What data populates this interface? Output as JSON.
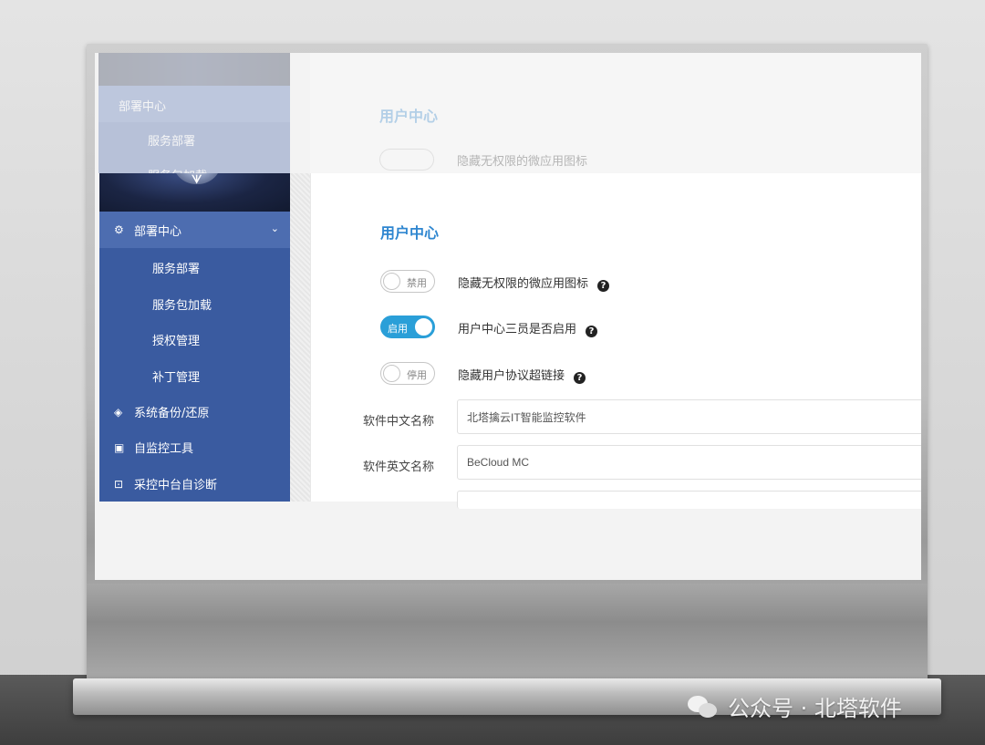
{
  "sidebar": {
    "section": {
      "label": "部署中心",
      "icon": "deploy-icon"
    },
    "sub_items": [
      "服务部署",
      "服务包加载",
      "授权管理",
      "补丁管理"
    ],
    "items": [
      {
        "label": "系统备份/还原",
        "icon": "layers-icon"
      },
      {
        "label": "自监控工具",
        "icon": "monitor-icon"
      },
      {
        "label": "采控中台自诊断",
        "icon": "diagnose-icon"
      }
    ],
    "ghost_partial": "服务包加载"
  },
  "main": {
    "section_title": "用户中心",
    "options": [
      {
        "state_label": "禁用",
        "on": false,
        "label": "隐藏无权限的微应用图标"
      },
      {
        "state_label": "启用",
        "on": true,
        "label": "用户中心三员是否启用"
      },
      {
        "state_label": "停用",
        "on": false,
        "label": "隐藏用户协议超链接"
      }
    ],
    "fields": [
      {
        "label": "软件中文名称",
        "value": "北塔擒云IT智能监控软件"
      },
      {
        "label": "软件英文名称",
        "value": "BeCloud MC"
      }
    ]
  },
  "watermark": {
    "text": "公众号 · 北塔软件",
    "icon": "wechat-icon"
  },
  "colors": {
    "sidebar": "#3a5ba0",
    "sidebar_active": "#4d6db0",
    "accent": "#2e86d0",
    "toggle_on": "#2a9fd8"
  }
}
